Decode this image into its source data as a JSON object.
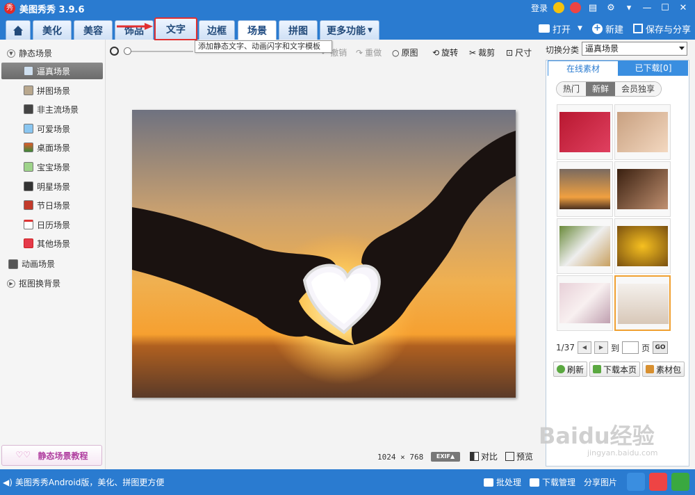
{
  "app": {
    "title": "美图秀秀 3.9.6",
    "logo_text": "秀",
    "login": "登录"
  },
  "menu": {
    "tabs": [
      "美化",
      "美容",
      "饰品",
      "文字",
      "边框",
      "场景",
      "拼图",
      "更多功能"
    ],
    "active_tab": "场景",
    "highlighted_tab": "文字",
    "open_label": "打开",
    "new_label": "新建",
    "save_label": "保存与分享"
  },
  "tooltip": "添加静态文字、动画闪字和文字模板",
  "toolbar": {
    "undo": "撤销",
    "redo": "重做",
    "original": "原图",
    "rotate": "旋转",
    "crop": "裁剪",
    "size": "尺寸"
  },
  "sidebar": {
    "group_static": "静态场景",
    "items": [
      "逼真场景",
      "拼图场景",
      "非主流场景",
      "可爱场景",
      "桌面场景",
      "宝宝场景",
      "明星场景",
      "节日场景",
      "日历场景",
      "其他场景"
    ],
    "selected_index": 0,
    "group_anim": "动画场景",
    "group_cutout": "抠图换背景",
    "tutorial": "静态场景教程"
  },
  "canvas": {
    "dimensions": "1024 × 768",
    "exif": "EXIF▲",
    "compare": "对比",
    "preview": "预览"
  },
  "right_panel": {
    "switch_label": "切换分类",
    "category": "逼真场景",
    "tabs": [
      "在线素材",
      "已下载[0]"
    ],
    "filters": [
      "热门",
      "新鲜",
      "会员独享"
    ],
    "active_filter": "新鲜",
    "page_info": "1/37",
    "goto_label": "到",
    "page_suffix": "页",
    "go": "GO",
    "refresh": "刷新",
    "download_page": "下载本页",
    "package": "素材包"
  },
  "statusbar": {
    "promo": "美图秀秀Android版，美化、拼图更方便",
    "batch": "批处理",
    "download_manager": "下载管理",
    "share": "分享图片"
  },
  "watermark": {
    "text": "Baidu经验",
    "sub": "jingyan.baidu.com"
  },
  "colors": {
    "brand_blue": "#2a7bd0",
    "highlight_red": "#e23030",
    "selected_orange": "#f0a030"
  }
}
